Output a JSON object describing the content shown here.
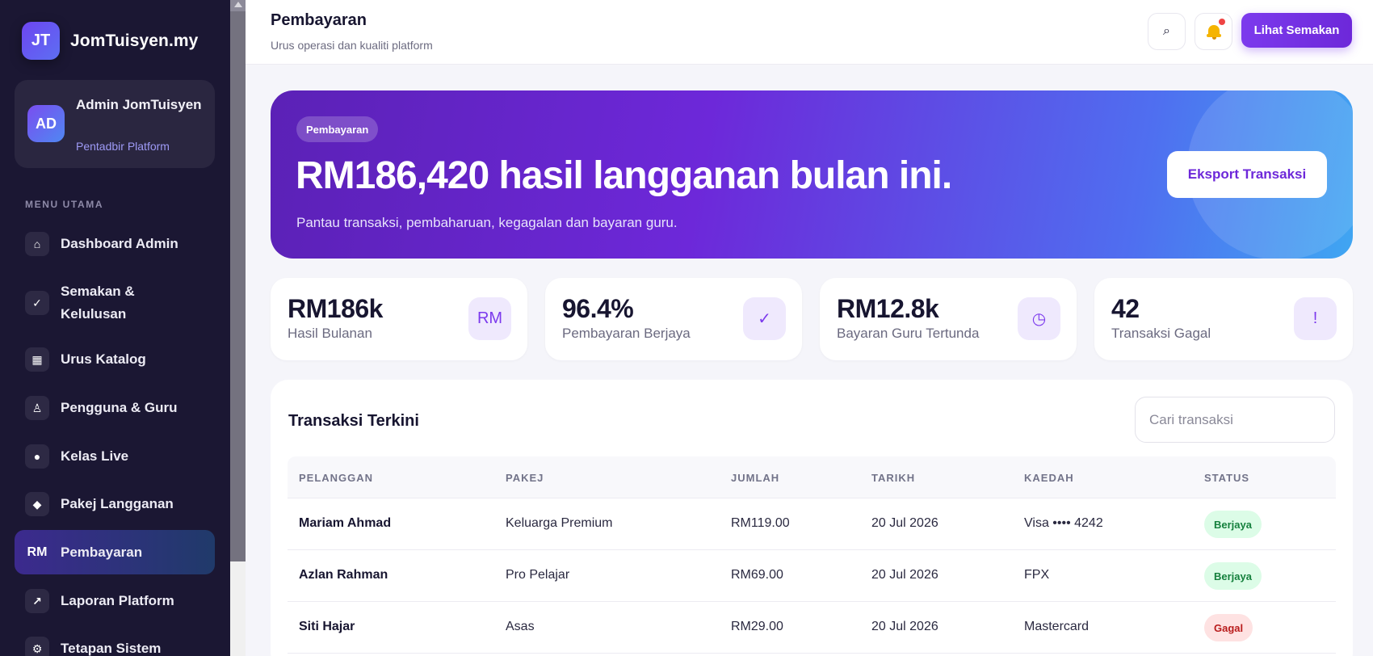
{
  "brand": {
    "logo": "JT",
    "name": "JomTuisyen.my"
  },
  "profile": {
    "initials": "AD",
    "name": "Admin JomTuisyen",
    "role": "Pentadbir Platform"
  },
  "menu": {
    "heading": "MENU UTAMA",
    "items": [
      {
        "icon": "⌂",
        "label": "Dashboard Admin"
      },
      {
        "icon": "✓",
        "label": "Semakan & Kelulusan"
      },
      {
        "icon": "▦",
        "label": "Urus Katalog"
      },
      {
        "icon": "♙",
        "label": "Pengguna & Guru"
      },
      {
        "icon": "●",
        "label": "Kelas Live"
      },
      {
        "icon": "◆",
        "label": "Pakej Langganan"
      },
      {
        "icon": "RM",
        "label": "Pembayaran"
      },
      {
        "icon": "↗",
        "label": "Laporan Platform"
      },
      {
        "icon": "⚙",
        "label": "Tetapan Sistem"
      }
    ]
  },
  "header": {
    "title": "Pembayaran",
    "subtitle": "Urus operasi dan kualiti platform",
    "search_icon": "⌕",
    "review_button": "Lihat Semakan"
  },
  "hero": {
    "pill": "Pembayaran",
    "headline": "RM186,420 hasil langganan bulan ini.",
    "description": "Pantau transaksi, pembaharuan, kegagalan dan bayaran guru.",
    "export_button": "Eksport Transaksi"
  },
  "stats": [
    {
      "value": "RM186k",
      "label": "Hasil Bulanan",
      "icon": "RM"
    },
    {
      "value": "96.4%",
      "label": "Pembayaran Berjaya",
      "icon": "✓"
    },
    {
      "value": "RM12.8k",
      "label": "Bayaran Guru Tertunda",
      "icon": "◷"
    },
    {
      "value": "42",
      "label": "Transaksi Gagal",
      "icon": "!"
    }
  ],
  "transactions": {
    "title": "Transaksi Terkini",
    "search_placeholder": "Cari transaksi",
    "columns": [
      "PELANGGAN",
      "PAKEJ",
      "JUMLAH",
      "TARIKH",
      "KAEDAH",
      "STATUS"
    ],
    "rows": [
      {
        "customer": "Mariam Ahmad",
        "package": "Keluarga Premium",
        "amount": "RM119.00",
        "date": "20 Jul 2026",
        "method": "Visa •••• 4242",
        "status": "Berjaya"
      },
      {
        "customer": "Azlan Rahman",
        "package": "Pro Pelajar",
        "amount": "RM69.00",
        "date": "20 Jul 2026",
        "method": "FPX",
        "status": "Berjaya"
      },
      {
        "customer": "Siti Hajar",
        "package": "Asas",
        "amount": "RM29.00",
        "date": "20 Jul 2026",
        "method": "Mastercard",
        "status": "Gagal"
      }
    ]
  }
}
